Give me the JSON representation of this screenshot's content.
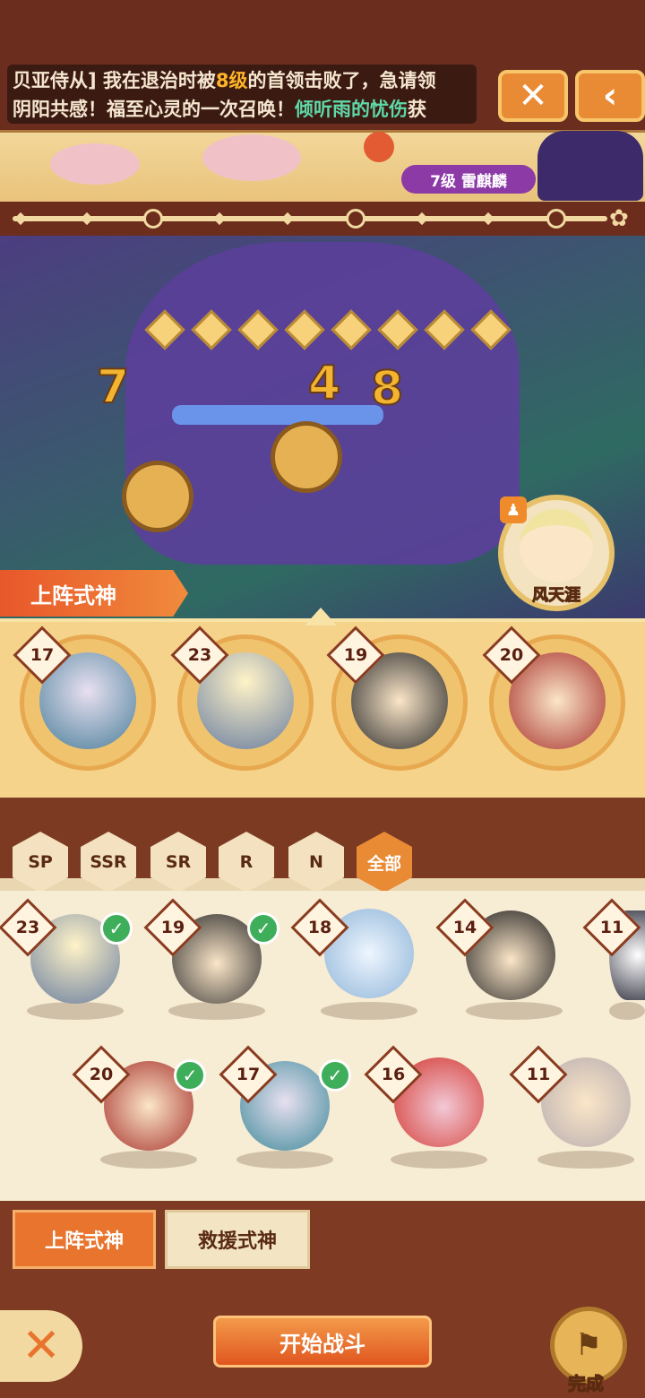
{
  "ticker": {
    "line1_a": "贝亚侍从] 我在退治时被",
    "line1_b": "8级",
    "line1_c": "的首领击败了，急请领",
    "line2_a": "阴阳共感！福至心灵的一次召唤！",
    "line2_b": "倾听雨的忧伤",
    "line2_c": "获"
  },
  "top_buttons": {
    "close": "✕",
    "back": "‹"
  },
  "banner": {
    "boss_label": "7级 雷麒麟"
  },
  "boss": {
    "numbers": [
      "7",
      "4",
      "8"
    ]
  },
  "helper": {
    "name": "风天涯"
  },
  "deploy_title": "上阵式神",
  "team": [
    {
      "level": "17"
    },
    {
      "level": "23"
    },
    {
      "level": "19"
    },
    {
      "level": "20"
    }
  ],
  "filters": [
    "SP",
    "SSR",
    "SR",
    "R",
    "N",
    "全部"
  ],
  "active_filter": "全部",
  "roster": [
    {
      "level": "23",
      "selected": true
    },
    {
      "level": "19",
      "selected": true
    },
    {
      "level": "18",
      "selected": false
    },
    {
      "level": "14",
      "selected": false
    },
    {
      "level": "11",
      "selected": false
    },
    {
      "level": "20",
      "selected": true
    },
    {
      "level": "17",
      "selected": true
    },
    {
      "level": "16",
      "selected": false
    },
    {
      "level": "11",
      "selected": false
    }
  ],
  "bottom_tabs": {
    "deploy": "上阵式神",
    "rescue": "救援式神"
  },
  "start_button": "开始战斗",
  "done_button": "完成",
  "colors": {
    "accent": "#e8742e",
    "selected_check": "#3fae5a",
    "highlight_yellow": "#ffb429",
    "highlight_green": "#5fd8a8"
  }
}
